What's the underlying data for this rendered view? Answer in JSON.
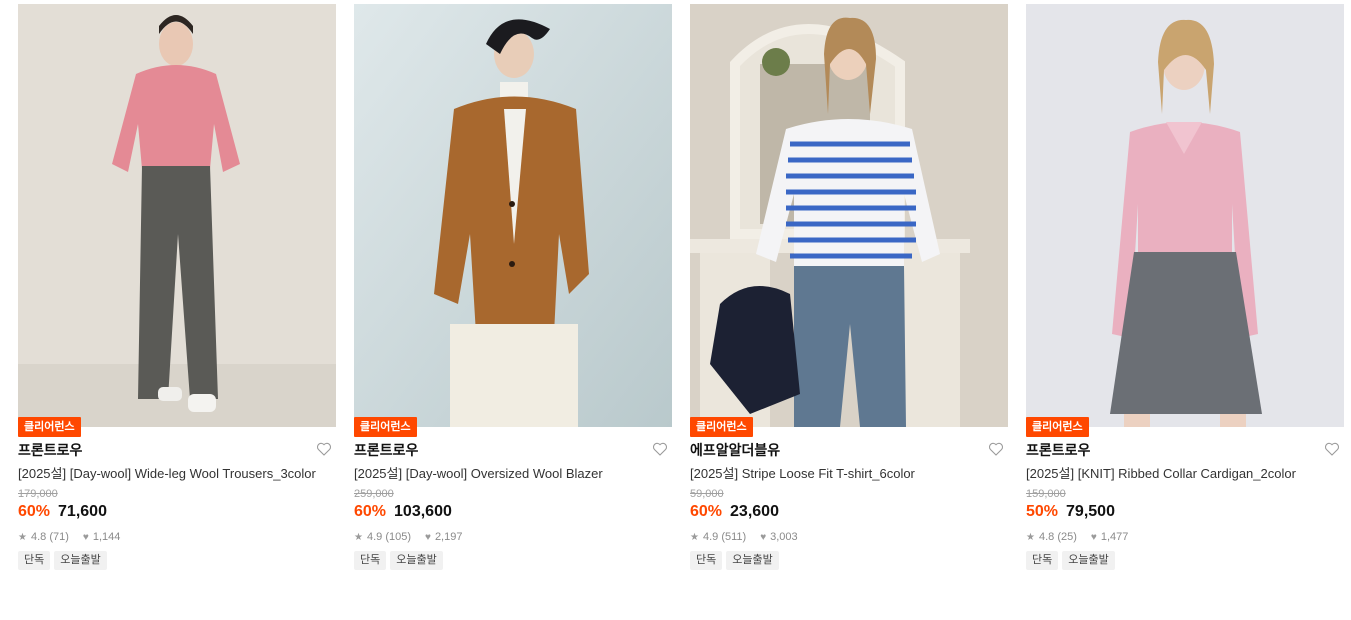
{
  "products": [
    {
      "badge": "클리어런스",
      "brand": "프론트로우",
      "title": "[2025설] [Day-wool] Wide-leg Wool Trousers_3color",
      "original_price": "179,000",
      "discount": "60%",
      "price": "71,600",
      "rating": "4.8 (71)",
      "likes": "1,144",
      "tags": [
        "단독",
        "오늘출발"
      ],
      "colors": {
        "bg": "#e3ded6",
        "top": "#e48a95",
        "bottom": "#5a5a56",
        "skin": "#e9c8b4"
      }
    },
    {
      "badge": "클리어런스",
      "brand": "프론트로우",
      "title": "[2025설] [Day-wool] Oversized Wool Blazer",
      "original_price": "259,000",
      "discount": "60%",
      "price": "103,600",
      "rating": "4.9 (105)",
      "likes": "2,197",
      "tags": [
        "단독",
        "오늘출발"
      ],
      "colors": {
        "bg": "#c7d4d6",
        "top": "#a8682e",
        "bottom": "#f1ede2",
        "skin": "#e8cdb8"
      }
    },
    {
      "badge": "클리어런스",
      "brand": "에프알알더블유",
      "title": "[2025설] Stripe Loose Fit T-shirt_6color",
      "original_price": "59,000",
      "discount": "60%",
      "price": "23,600",
      "rating": "4.9 (511)",
      "likes": "3,003",
      "tags": [
        "단독",
        "오늘출발"
      ],
      "colors": {
        "bg": "#d9d2c7",
        "top": "#f4f4f6",
        "bottom": "#5f7891",
        "skin": "#ecd0bb"
      }
    },
    {
      "badge": "클리어런스",
      "brand": "프론트로우",
      "title": "[2025설] [KNIT] Ribbed Collar Cardigan_2color",
      "original_price": "159,000",
      "discount": "50%",
      "price": "79,500",
      "rating": "4.8 (25)",
      "likes": "1,477",
      "tags": [
        "단독",
        "오늘출발"
      ],
      "colors": {
        "bg": "#e4e5ea",
        "top": "#eab0c0",
        "bottom": "#6b6f75",
        "skin": "#ecd1c1"
      }
    }
  ]
}
